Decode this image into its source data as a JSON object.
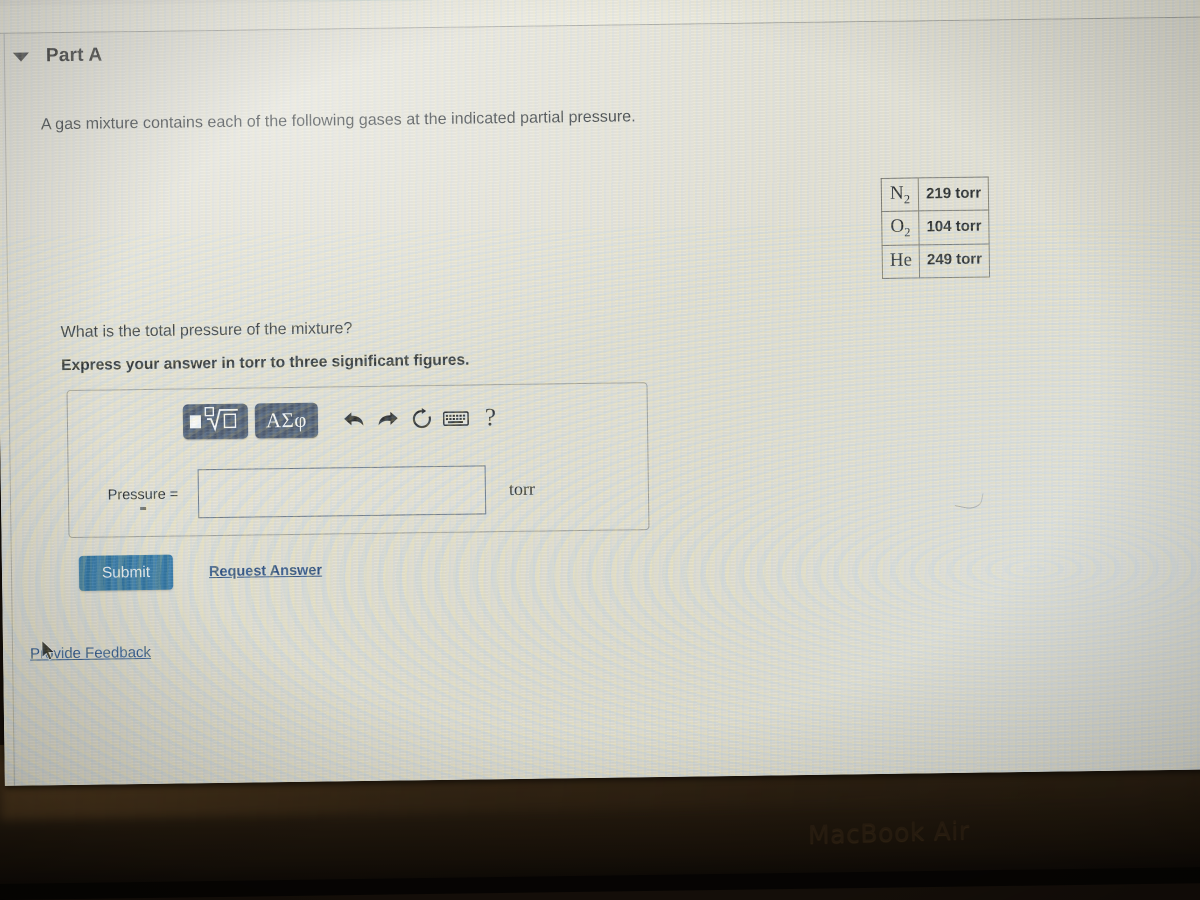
{
  "part": {
    "toggle_icon": "triangle-down-icon",
    "title": "Part A"
  },
  "problem": {
    "intro": "A gas mixture contains each of the following gases at the indicated partial pressure.",
    "question": "What is the total pressure of the mixture?",
    "instruction": "Express your answer in torr to three significant figures."
  },
  "gas_table": {
    "rows": [
      {
        "symbol": "N",
        "subscript": "2",
        "pressure": "219 torr"
      },
      {
        "symbol": "O",
        "subscript": "2",
        "pressure": "104 torr"
      },
      {
        "symbol": "He",
        "subscript": "",
        "pressure": "249 torr"
      }
    ]
  },
  "toolbar": {
    "template_button": "template-icon",
    "greek_button": "ΑΣφ",
    "undo_icon": "undo-arrow-icon",
    "redo_icon": "redo-arrow-icon",
    "reset_icon": "reset-circular-arrow-icon",
    "keyboard_icon": "keyboard-icon",
    "help_icon": "?"
  },
  "answer": {
    "label": "Pressure =",
    "value": "",
    "placeholder": "",
    "unit": "torr"
  },
  "actions": {
    "submit_label": "Submit",
    "request_answer_label": "Request Answer",
    "provide_feedback_label": "Provide Feedback"
  },
  "device": {
    "bezel_label": "MacBook Air"
  },
  "colors": {
    "submit_blue": "#1c6a9e",
    "link_blue": "#19407a",
    "toolbar_button": "#3b4a63",
    "top_band_teal": "#82b2ac",
    "page_background": "#e4e2d7"
  }
}
